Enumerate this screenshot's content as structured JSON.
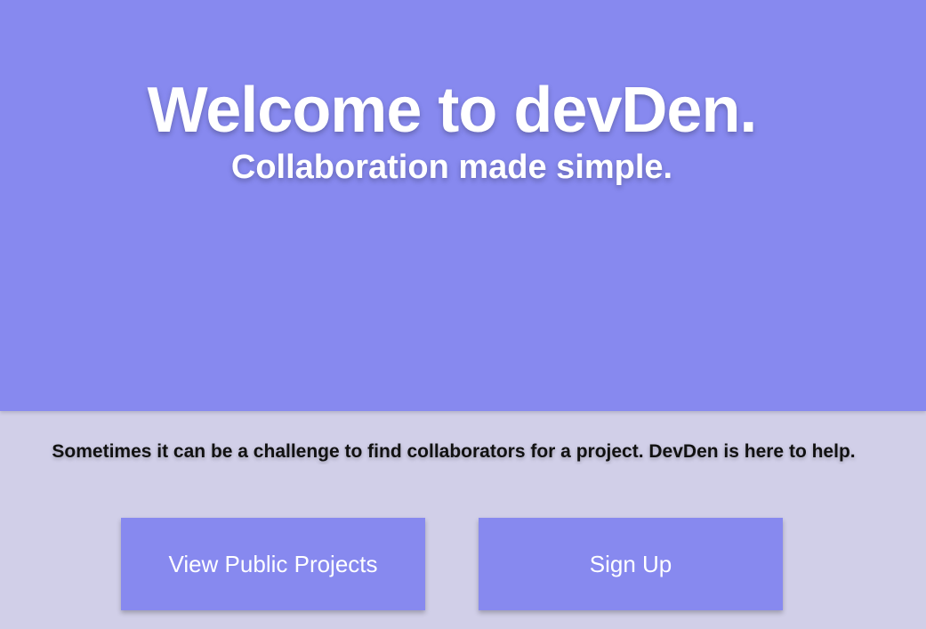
{
  "hero": {
    "title": "Welcome to devDen.",
    "subtitle": "Collaboration made simple."
  },
  "main": {
    "tagline": "Sometimes it can be a challenge to find collaborators for a project. DevDen is here to help.",
    "buttons": {
      "view_projects_label": "View Public Projects",
      "sign_up_label": "Sign Up"
    }
  },
  "colors": {
    "primary": "#8789ef",
    "background": "#d1cfe8",
    "hero_text": "#ffffff",
    "body_text": "#111111"
  }
}
